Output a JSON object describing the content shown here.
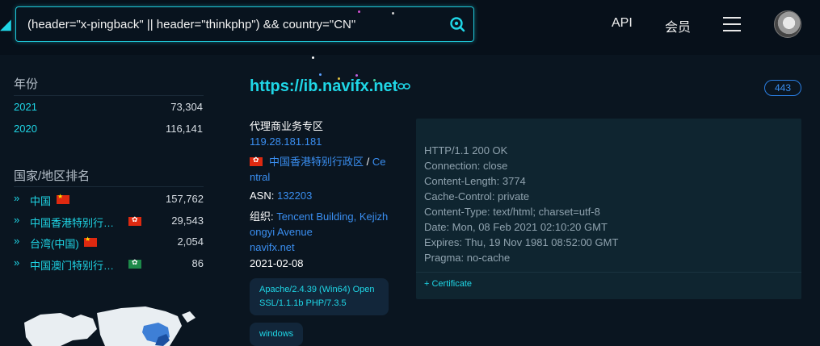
{
  "search": {
    "query": "(header=\"x-pingback\" || header=\"thinkphp\") && country=\"CN\""
  },
  "nav": {
    "api_label": "API",
    "member_label": "会员"
  },
  "sidebar": {
    "year_section_title": "年份",
    "years": [
      {
        "label": "2021",
        "count": "73,304"
      },
      {
        "label": "2020",
        "count": "116,141"
      }
    ],
    "country_section_title": "国家/地区排名",
    "countries": [
      {
        "name": "中国",
        "flag": "cn",
        "count": "157,762"
      },
      {
        "name": "中国香港特别行…",
        "flag": "hk",
        "count": "29,543"
      },
      {
        "name": "台湾(中国)",
        "flag": "cn",
        "count": "2,054"
      },
      {
        "name": "中国澳门特别行…",
        "flag": "mo",
        "count": "86"
      }
    ]
  },
  "result": {
    "url": "https://ib.navifx.net",
    "port": "443",
    "title": "代理商业务专区",
    "ip": "119.28.181.181",
    "location_line1": "中国香港特别行政区",
    "location_sep": " / ",
    "location_city_part1": "Ce",
    "location_city_part2": "ntral",
    "asn_label": "ASN: ",
    "asn_value": "132203",
    "org_label": "组织: ",
    "org_value_line1": "Tencent Building, Kejizh",
    "org_value_line2": "ongyi Avenue",
    "domain": "navifx.net",
    "date": "2021-02-08",
    "tags": [
      {
        "line1": "Apache/2.4.39 (Win64) Open",
        "line2": "SSL/1.1.1b PHP/7.3.5"
      },
      {
        "line1": "windows"
      }
    ],
    "http_header": [
      "HTTP/1.1 200 OK",
      "Connection: close",
      "Content-Length: 3774",
      "Cache-Control: private",
      "Content-Type: text/html; charset=utf-8",
      "Date: Mon, 08 Feb 2021 02:10:20 GMT",
      "Expires: Thu, 19 Nov 1981 08:52:00 GMT",
      "Pragma: no-cache"
    ],
    "certificate_label": "+ Certificate"
  },
  "colors": {
    "accent": "#1fd6e6",
    "link": "#3a8ef0",
    "background": "#0a1520"
  },
  "icons": [
    "search-icon",
    "link-icon",
    "menu-icon",
    "chevron-double-right-icon",
    "flag-icon",
    "world-map"
  ]
}
